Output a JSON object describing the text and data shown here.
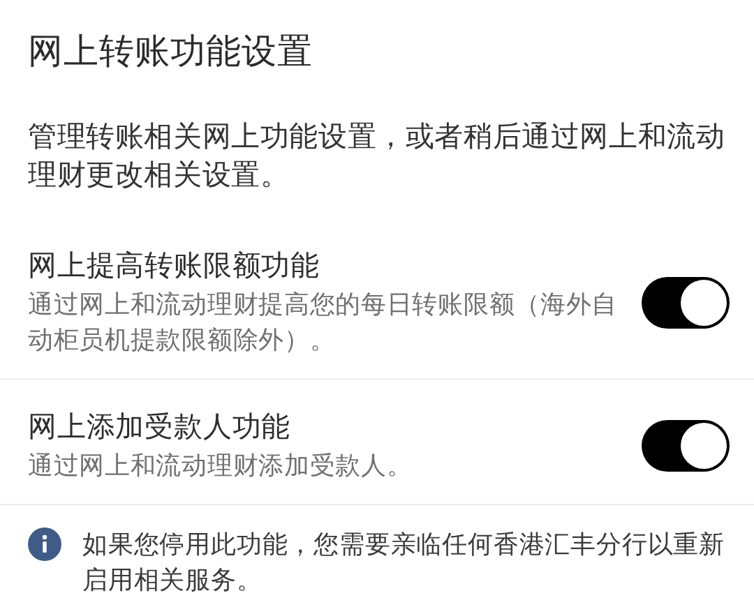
{
  "page": {
    "title": "网上转账功能设置",
    "description": "管理转账相关网上功能设置，或者稍后通过网上和流动理财更改相关设置。"
  },
  "settings": [
    {
      "title": "网上提高转账限额功能",
      "description": "通过网上和流动理财提高您的每日转账限额（海外自动柜员机提款限额除外）。",
      "on": true
    },
    {
      "title": "网上添加受款人功能",
      "description": "通过网上和流动理财添加受款人。",
      "on": true
    }
  ],
  "notice": {
    "text": "如果您停用此功能，您需要亲临任何香港汇丰分行以重新启用相关服务。"
  }
}
